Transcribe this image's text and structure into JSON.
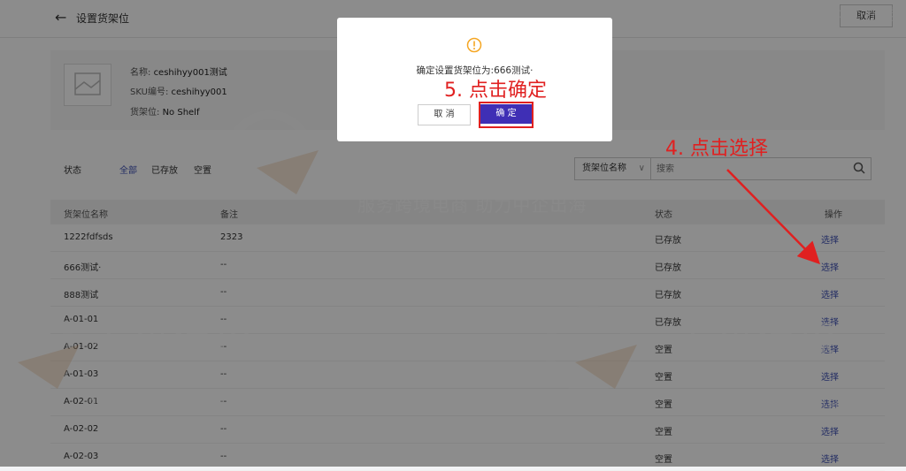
{
  "header": {
    "back_icon": "arrow-left-icon",
    "title": "设置货架位",
    "cancel_label": "取消"
  },
  "product": {
    "name_label": "名称:",
    "name_value": "ceshihyy001测试",
    "sku_label": "SKU编号:",
    "sku_value": "ceshihyy001",
    "shelf_label": "货架位:",
    "shelf_value": "No Shelf"
  },
  "filter": {
    "status_label": "状态",
    "options": [
      "全部",
      "已存放",
      "空置"
    ],
    "active_option": "全部"
  },
  "search": {
    "field_selected": "货架位名称",
    "placeholder": "搜索"
  },
  "table": {
    "headers": [
      "货架位名称",
      "备注",
      "状态",
      "操作"
    ],
    "rows": [
      [
        "1222fdfsds",
        "2323",
        "已存放",
        "选择"
      ],
      [
        "666测试·",
        "--",
        "已存放",
        "选择"
      ],
      [
        "888测试",
        "--",
        "已存放",
        "选择"
      ],
      [
        "A-01-01",
        "--",
        "已存放",
        "选择"
      ],
      [
        "A-01-02",
        "--",
        "空置",
        "选择"
      ],
      [
        "A-01-03",
        "--",
        "空置",
        "选择"
      ],
      [
        "A-02-01",
        "--",
        "空置",
        "选择"
      ],
      [
        "A-02-02",
        "--",
        "空置",
        "选择"
      ],
      [
        "A-02-03",
        "--",
        "空置",
        "选择"
      ]
    ]
  },
  "dialog": {
    "icon": "warning-icon",
    "message": "确定设置货架位为:666测试·",
    "cancel_label": "取 消",
    "confirm_label": "确 定"
  },
  "annotations": {
    "step5": "5. 点击确定",
    "step4": "4. 点击选择"
  },
  "watermark": {
    "brand": "主机侦探",
    "slogan": "服务跨境电商 助力中企出海"
  },
  "colors": {
    "accent": "#3f51b5",
    "confirm_button": "#3f2fb5",
    "annotation_red": "#e02020",
    "warning": "#f5a623"
  }
}
